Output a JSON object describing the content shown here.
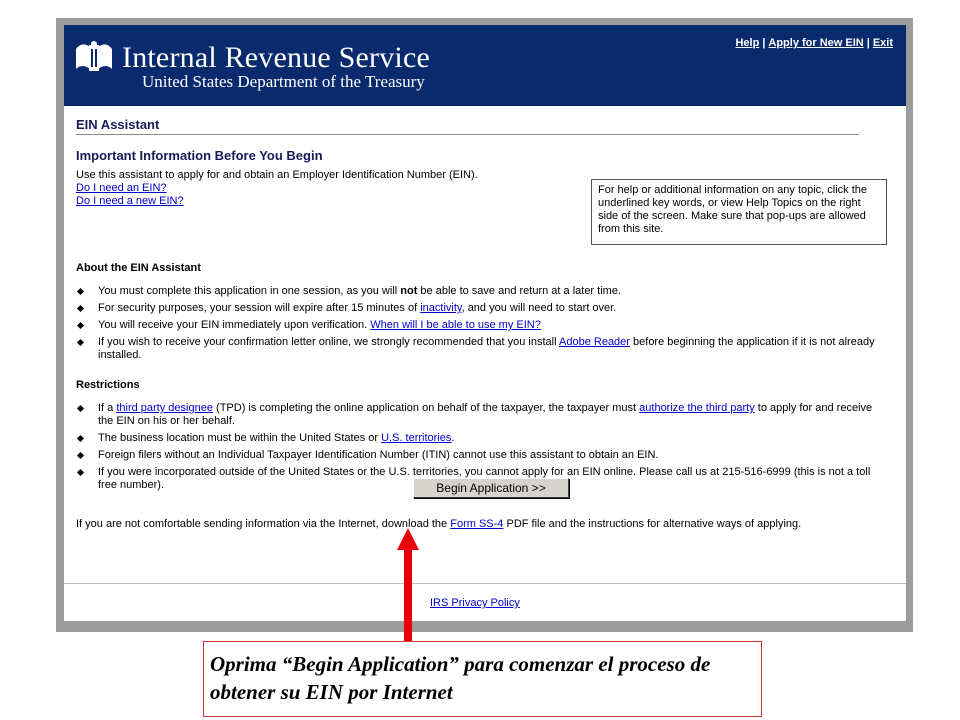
{
  "header": {
    "org_name": "Internal Revenue Service",
    "org_sub": "United States Department of the Treasury",
    "links": {
      "help": "Help",
      "apply_new": "Apply for New EIN",
      "exit": "Exit",
      "separator": "|"
    },
    "background_color": "#0a2a6e"
  },
  "content": {
    "assistant_title": "EIN Assistant",
    "section_heading": "Important Information Before You Begin",
    "intro_text": "Use this assistant to apply for and obtain an Employer Identification Number (EIN).",
    "intro_links": [
      "Do I need an EIN?",
      "Do I need a new EIN?"
    ],
    "help_box": "For help or additional information on any topic, click the underlined key words, or view Help Topics on the right side of the screen. Make sure that pop-ups are allowed from this site.",
    "about_heading": "About the EIN Assistant",
    "about_items": [
      {
        "before": "You must complete this application in one session, as you will ",
        "bold": "not",
        "after": " be able to save and return at a later time."
      },
      {
        "before": "For security purposes, your session will expire after 15 minutes of ",
        "link": "inactivity",
        "after": ", and you will need to start over."
      },
      {
        "before": "You will receive your EIN immediately upon verification. ",
        "link": "When will I be able to use my EIN?",
        "after": ""
      },
      {
        "before": "If you wish to receive your confirmation letter online, we strongly recommended that you install ",
        "link": "Adobe Reader",
        "after": " before beginning the application if it is not already installed."
      }
    ],
    "restrictions_heading": "Restrictions",
    "restriction_items": [
      {
        "before": "If a ",
        "link": "third party designee",
        "mid": " (TPD) is completing the online application on behalf of the taxpayer, the taxpayer must ",
        "link2": "authorize the third party",
        "after": " to apply for and receive the EIN on his or her behalf."
      },
      {
        "before": "The business location must be within the United States or ",
        "link": "U.S. territories",
        "after": "."
      },
      {
        "before": "Foreign filers without an Individual Taxpayer Identification Number (ITIN) cannot use this assistant to obtain an EIN.",
        "link": "",
        "after": ""
      },
      {
        "before": "If you were incorporated outside of the United States or the U.S. territories, you cannot apply for an EIN online. Please call us at 215-516-6999 (this is not a toll free number).",
        "link": "",
        "after": ""
      }
    ],
    "begin_button": "Begin Application >>",
    "footer_before": "If you are not comfortable sending information via the Internet, download the ",
    "footer_link": "Form SS-4",
    "footer_after": " PDF file and the instructions for alternative ways of applying.",
    "privacy_link": "IRS Privacy Policy"
  },
  "annotation": {
    "callout_text": "Oprima “Begin Application” para comenzar el proceso de obtener su EIN por Internet",
    "arrow_color": "#e8000b"
  }
}
